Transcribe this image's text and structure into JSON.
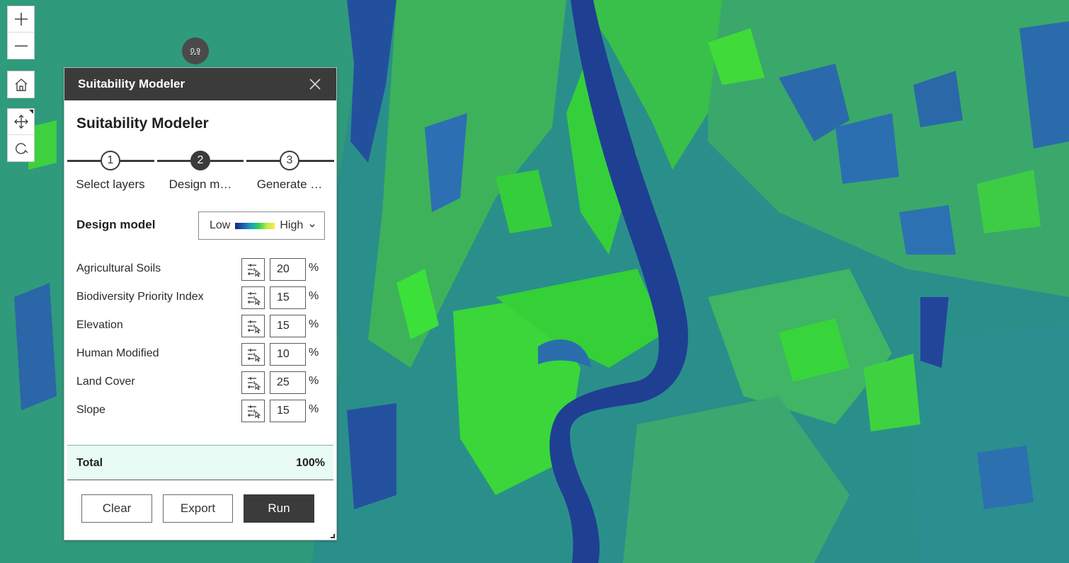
{
  "map": {
    "colors": {
      "base": "#2a8f8a",
      "river": "#1f3f93",
      "bright": "#35d23a",
      "mid": "#3fb060",
      "blue": "#2a6eae",
      "teal": "#2a9a8c"
    }
  },
  "controls": {
    "zoom_in_icon": "plus-icon",
    "zoom_out_icon": "minus-icon",
    "home_icon": "home-icon",
    "pan_icon": "move-arrows-icon",
    "rotate_icon": "rotate-icon"
  },
  "scale_badge": "0.9",
  "panel": {
    "header_title": "Suitability Modeler",
    "title": "Suitability Modeler",
    "steps": [
      {
        "number": "1",
        "label": "Select layers",
        "active": false
      },
      {
        "number": "2",
        "label": "Design m…",
        "active": true
      },
      {
        "number": "3",
        "label": "Generate …",
        "active": false
      }
    ],
    "design_model": {
      "label": "Design model",
      "ramp_low": "Low",
      "ramp_high": "High"
    },
    "layers": [
      {
        "name": "Agricultural Soils",
        "weight": "20",
        "unit": "%"
      },
      {
        "name": "Biodiversity Priority Index",
        "weight": "15",
        "unit": "%"
      },
      {
        "name": "Elevation",
        "weight": "15",
        "unit": "%"
      },
      {
        "name": "Human Modified",
        "weight": "10",
        "unit": "%"
      },
      {
        "name": "Land Cover",
        "weight": "25",
        "unit": "%"
      },
      {
        "name": "Slope",
        "weight": "15",
        "unit": "%"
      }
    ],
    "total": {
      "label": "Total",
      "value": "100%"
    },
    "buttons": {
      "clear": "Clear",
      "export": "Export",
      "run": "Run"
    }
  }
}
